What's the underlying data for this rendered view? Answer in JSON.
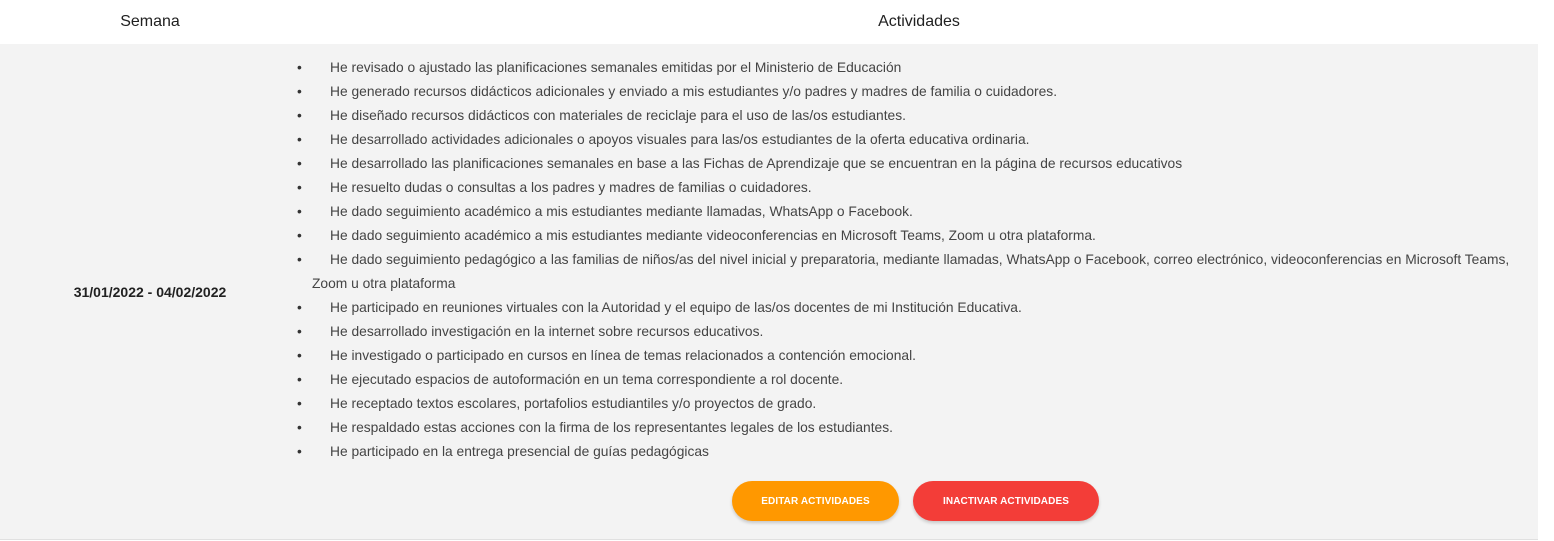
{
  "table": {
    "headers": {
      "week": "Semana",
      "activities": "Actividades"
    },
    "rows": [
      {
        "week": "31/01/2022 - 04/02/2022",
        "activities": [
          "He revisado o ajustado las planificaciones semanales emitidas por el Ministerio de Educación",
          "He generado recursos didácticos adicionales y enviado a mis estudiantes y/o padres y madres de familia o cuidadores.",
          "He diseñado recursos didácticos con materiales de reciclaje para el uso de las/os estudiantes.",
          "He desarrollado actividades adicionales o apoyos visuales para las/os estudiantes de la oferta educativa ordinaria.",
          "He desarrollado las planificaciones semanales en base a las Fichas de Aprendizaje que se encuentran en la página de recursos educativos",
          "He resuelto dudas o consultas a los padres y madres de familias o cuidadores.",
          "He dado seguimiento académico a mis estudiantes mediante llamadas, WhatsApp o Facebook.",
          "He dado seguimiento académico a mis estudiantes mediante videoconferencias en Microsoft Teams, Zoom u otra plataforma.",
          "He dado seguimiento pedagógico a las familias de niños/as del nivel inicial y preparatoria, mediante llamadas, WhatsApp o Facebook, correo electrónico, videoconferencias en Microsoft Teams, Zoom u otra plataforma",
          "He participado en reuniones virtuales con la Autoridad y el equipo de las/os docentes de mi Institución Educativa.",
          "He desarrollado investigación en la internet sobre recursos educativos.",
          "He investigado o participado en cursos en línea de temas relacionados a contención emocional.",
          "He ejecutado espacios de autoformación en un tema correspondiente a rol docente.",
          "He receptado textos escolares, portafolios estudiantiles y/o proyectos de grado.",
          "He respaldado estas acciones con la firma de los representantes legales de los estudiantes.",
          "He participado en la entrega presencial de guías pedagógicas"
        ],
        "buttons": {
          "edit": "EDITAR ACTIVIDADES",
          "inactivate": "INACTIVAR ACTIVIDADES"
        }
      }
    ]
  },
  "colors": {
    "row_background": "#f3f3f3",
    "edit_button": "#ff9800",
    "inactivate_button": "#f33d38"
  }
}
